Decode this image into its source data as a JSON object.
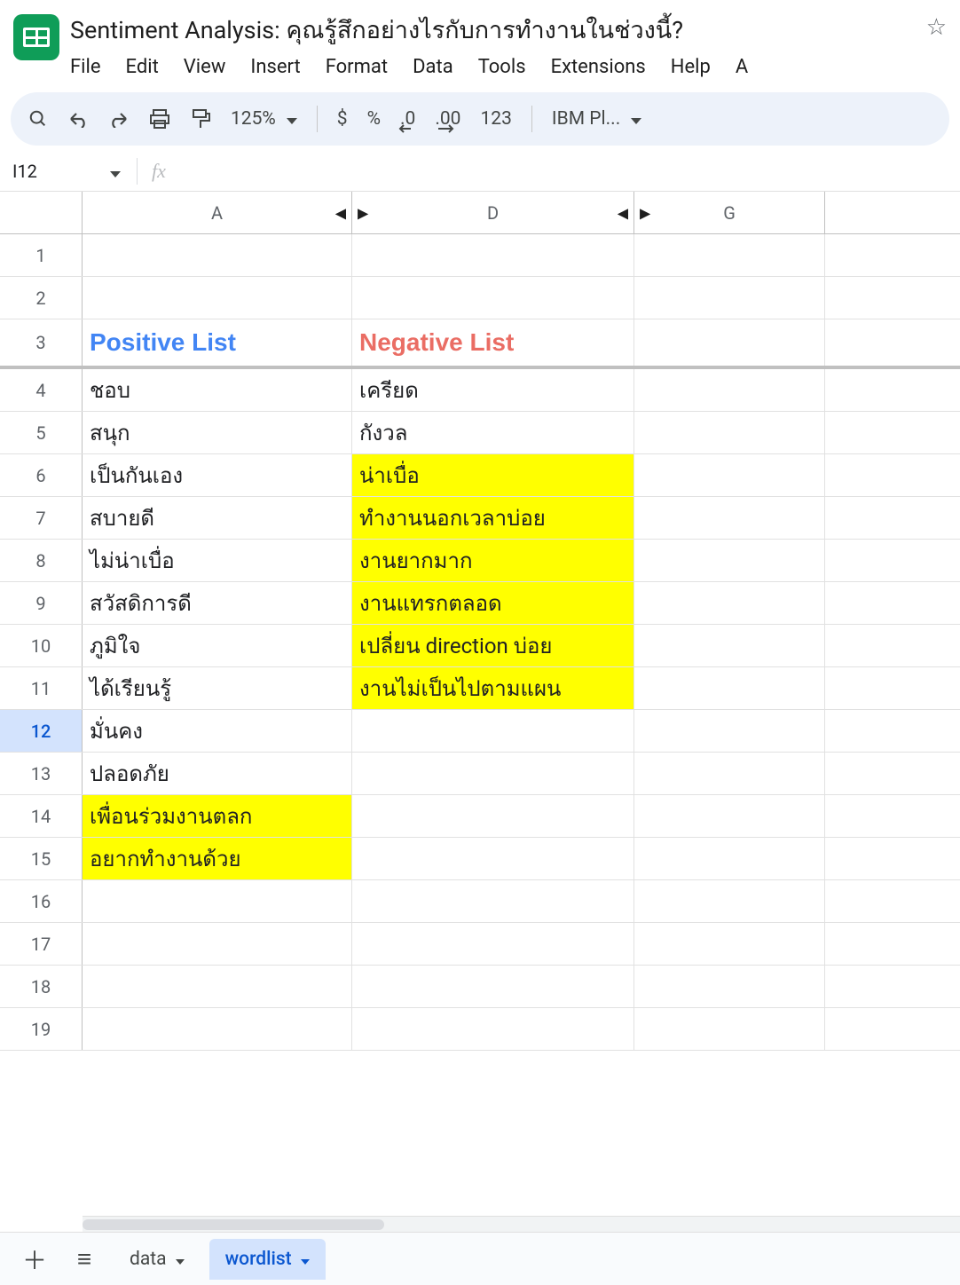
{
  "doc": {
    "title": "Sentiment Analysis: คุณรู้สึกอย่างไรกับการทำงานในช่วงนี้?"
  },
  "menubar": {
    "file": "File",
    "edit": "Edit",
    "view": "View",
    "insert": "Insert",
    "format": "Format",
    "data": "Data",
    "tools": "Tools",
    "extensions": "Extensions",
    "help": "Help",
    "accessibility": "A"
  },
  "toolbar": {
    "zoom": "125%",
    "currency": "$",
    "percent": "%",
    "dec_decrease": ".0",
    "dec_increase": ".00",
    "num_format": "123",
    "font": "IBM Pl..."
  },
  "namebox": {
    "ref": "I12"
  },
  "columns": {
    "A": "A",
    "D": "D",
    "G": "G"
  },
  "row_numbers": [
    "1",
    "2",
    "3",
    "4",
    "5",
    "6",
    "7",
    "8",
    "9",
    "10",
    "11",
    "12",
    "13",
    "14",
    "15",
    "16",
    "17",
    "18",
    "19"
  ],
  "headers": {
    "positive": "Positive List",
    "negative": "Negative List"
  },
  "table": {
    "positive": [
      {
        "text": "ชอบ",
        "hl": false
      },
      {
        "text": "สนุก",
        "hl": false
      },
      {
        "text": "เป็นกันเอง",
        "hl": false
      },
      {
        "text": "สบายดี",
        "hl": false
      },
      {
        "text": "ไม่น่าเบื่อ",
        "hl": false
      },
      {
        "text": "สวัสดิการดี",
        "hl": false
      },
      {
        "text": "ภูมิใจ",
        "hl": false
      },
      {
        "text": "ได้เรียนรู้",
        "hl": false
      },
      {
        "text": "มั่นคง",
        "hl": false
      },
      {
        "text": "ปลอดภัย",
        "hl": false
      },
      {
        "text": "เพื่อนร่วมงานตลก",
        "hl": true
      },
      {
        "text": "อยากทำงานด้วย",
        "hl": true
      }
    ],
    "negative": [
      {
        "text": "เครียด",
        "hl": false
      },
      {
        "text": "กังวล",
        "hl": false
      },
      {
        "text": "น่าเบื่อ",
        "hl": true
      },
      {
        "text": "ทำงานนอกเวลาบ่อย",
        "hl": true
      },
      {
        "text": "งานยากมาก",
        "hl": true
      },
      {
        "text": "งานแทรกตลอด",
        "hl": true
      },
      {
        "text": "เปลี่ยน direction บ่อย",
        "hl": true
      },
      {
        "text": "งานไม่เป็นไปตามแผน",
        "hl": true
      }
    ]
  },
  "selected_row": "12",
  "sheets": {
    "data": "data",
    "wordlist": "wordlist"
  }
}
